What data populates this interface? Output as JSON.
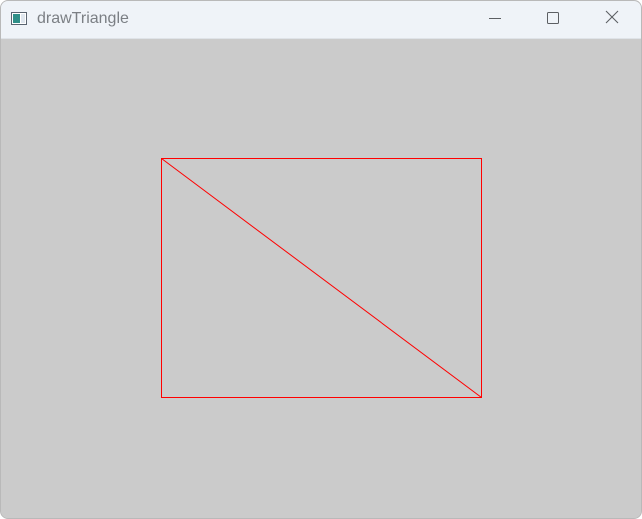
{
  "window": {
    "title": "drawTriangle",
    "icon": "app-window-icon",
    "controls": {
      "minimize_icon": "minimize-icon",
      "maximize_icon": "maximize-icon",
      "close_icon": "close-icon"
    }
  },
  "canvas": {
    "background_color": "#cbcbcb",
    "stroke_color": "#ff0000",
    "shapes": [
      "rectangle",
      "diagonal-line"
    ]
  }
}
